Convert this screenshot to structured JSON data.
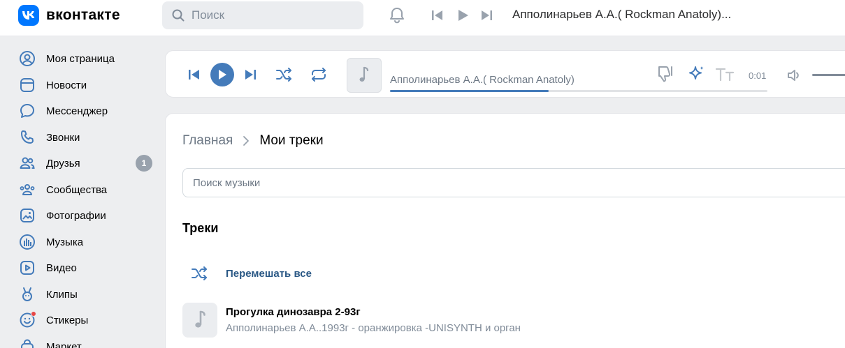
{
  "header": {
    "logo_text": "вконтакте",
    "search_placeholder": "Поиск",
    "now_playing": "Апполинарьев А.А.( Rockman Anatoly)..."
  },
  "sidebar": {
    "items": [
      {
        "label": "Моя страница",
        "icon": "profile-icon"
      },
      {
        "label": "Новости",
        "icon": "news-icon"
      },
      {
        "label": "Мессенджер",
        "icon": "messenger-icon"
      },
      {
        "label": "Звонки",
        "icon": "phone-icon"
      },
      {
        "label": "Друзья",
        "icon": "friends-icon",
        "badge": "1"
      },
      {
        "label": "Сообщества",
        "icon": "communities-icon"
      },
      {
        "label": "Фотографии",
        "icon": "photos-icon"
      },
      {
        "label": "Музыка",
        "icon": "music-icon"
      },
      {
        "label": "Видео",
        "icon": "video-icon"
      },
      {
        "label": "Клипы",
        "icon": "clips-icon"
      },
      {
        "label": "Стикеры",
        "icon": "stickers-icon"
      },
      {
        "label": "Маркет",
        "icon": "market-icon"
      }
    ]
  },
  "player": {
    "track_title": "Апполинарьев А.А.( Rockman Anatoly)",
    "time": "0:01",
    "progress": 0.42
  },
  "content": {
    "breadcrumb_home": "Главная",
    "breadcrumb_current": "Мои треки",
    "search_placeholder": "Поиск музыки",
    "section_title": "Треки",
    "shuffle_label": "Перемешать все",
    "tracks": [
      {
        "title": "Прогулка динозавра 2-93г",
        "artist": "Апполинарьев А.А..1993г - оранжировка -UNISYNTH и орган"
      }
    ]
  },
  "colors": {
    "accent": "#447bba",
    "brand": "#0077ff",
    "link": "#2a5885",
    "icon": "#447bba",
    "muted_icon": "#99a2ad"
  }
}
